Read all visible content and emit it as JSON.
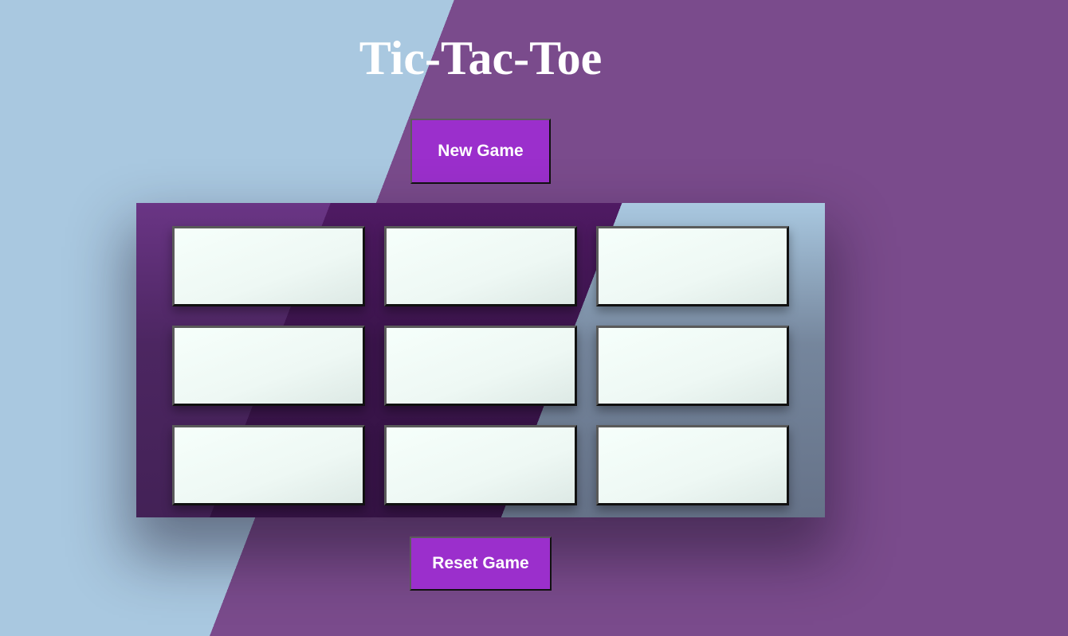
{
  "title": "Tic-Tac-Toe",
  "buttons": {
    "new_game": "New Game",
    "reset_game": "Reset Game"
  },
  "board": {
    "cells": [
      "",
      "",
      "",
      "",
      "",
      "",
      "",
      "",
      ""
    ]
  },
  "colors": {
    "background_light": "#a9c8e0",
    "background_purple": "#7a4b8c",
    "button": "#9b2fcc",
    "cell": "#f3fbf8"
  }
}
